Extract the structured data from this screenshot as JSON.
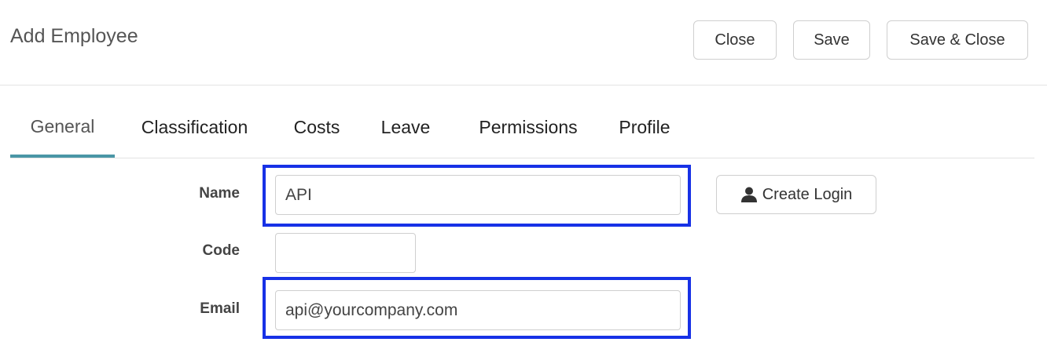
{
  "header": {
    "title": "Add Employee",
    "close_label": "Close",
    "save_label": "Save",
    "save_close_label": "Save & Close"
  },
  "tabs": [
    {
      "label": "General",
      "active": true
    },
    {
      "label": "Classification",
      "active": false
    },
    {
      "label": "Costs",
      "active": false
    },
    {
      "label": "Leave",
      "active": false
    },
    {
      "label": "Permissions",
      "active": false
    },
    {
      "label": "Profile",
      "active": false
    }
  ],
  "form": {
    "name": {
      "label": "Name",
      "value": "API"
    },
    "code": {
      "label": "Code",
      "value": ""
    },
    "email": {
      "label": "Email",
      "value": "api@yourcompany.com"
    },
    "create_login_label": "Create Login",
    "create_login_icon": "user-icon"
  },
  "colors": {
    "tab_active_underline": "#4a96a6",
    "highlight_border": "#1731e6"
  }
}
